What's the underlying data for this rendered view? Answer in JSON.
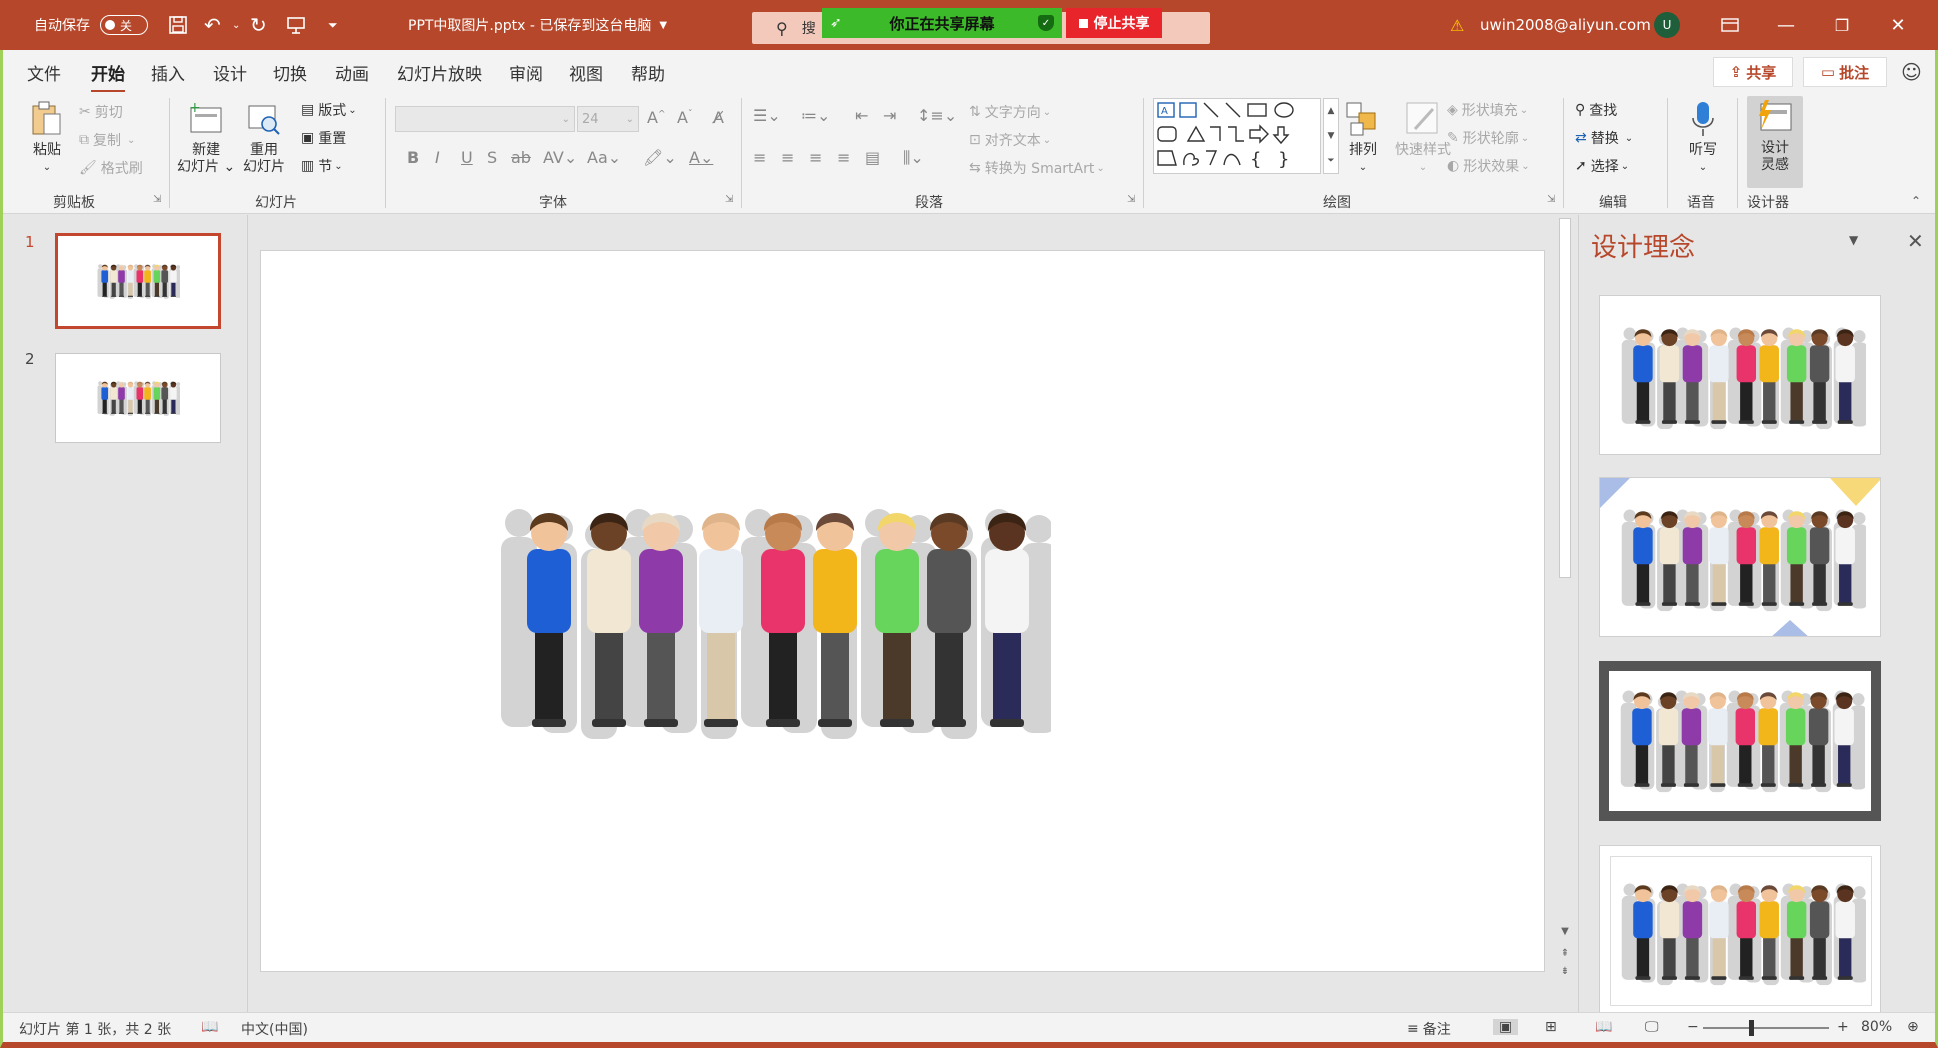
{
  "titlebar": {
    "autosave_label": "自动保存",
    "autosave_state": "关",
    "doc_title": "PPT中取图片.pptx - 已保存到这台电脑",
    "search_placeholder": "搜",
    "sharing_banner": "你正在共享屏幕",
    "stop_sharing": "停止共享",
    "account": "uwin2008@aliyun.com",
    "avatar_initial": "U"
  },
  "menu": {
    "tabs": [
      "文件",
      "开始",
      "插入",
      "设计",
      "切换",
      "动画",
      "幻灯片放映",
      "审阅",
      "视图",
      "帮助"
    ],
    "active_tab": "开始",
    "share_label": "共享",
    "comment_label": "批注"
  },
  "ribbon": {
    "clipboard": {
      "paste": "粘贴",
      "cut": "剪切",
      "copy": "复制",
      "format_painter": "格式刷",
      "group": "剪贴板"
    },
    "slides": {
      "new_slide_1": "新建",
      "new_slide_2": "幻灯片",
      "reuse_1": "重用",
      "reuse_2": "幻灯片",
      "layout": "版式",
      "reset": "重置",
      "section": "节",
      "group": "幻灯片"
    },
    "font": {
      "size": "24",
      "group": "字体"
    },
    "paragraph": {
      "text_direction": "文字方向",
      "align_text": "对齐文本",
      "smartart": "转换为 SmartArt",
      "group": "段落"
    },
    "drawing": {
      "arrange": "排列",
      "quick_styles": "快速样式",
      "shape_fill": "形状填充",
      "shape_outline": "形状轮廓",
      "shape_effects": "形状效果",
      "group": "绘图"
    },
    "editing": {
      "find": "查找",
      "replace": "替换",
      "select": "选择",
      "group": "编辑"
    },
    "voice": {
      "dictate": "听写",
      "group": "语音"
    },
    "designer": {
      "label_1": "设计",
      "label_2": "灵感",
      "group": "设计器"
    }
  },
  "thumbnails": {
    "numbers": [
      "1",
      "2"
    ]
  },
  "design_pane": {
    "title": "设计理念"
  },
  "status": {
    "slide_info": "幻灯片 第 1 张，共 2 张",
    "language": "中文(中国)",
    "notes": "备注",
    "zoom": "80%"
  },
  "colors": {
    "accent": "#b7472a",
    "share_green": "#3cba29",
    "stop_red": "#e8252b"
  }
}
